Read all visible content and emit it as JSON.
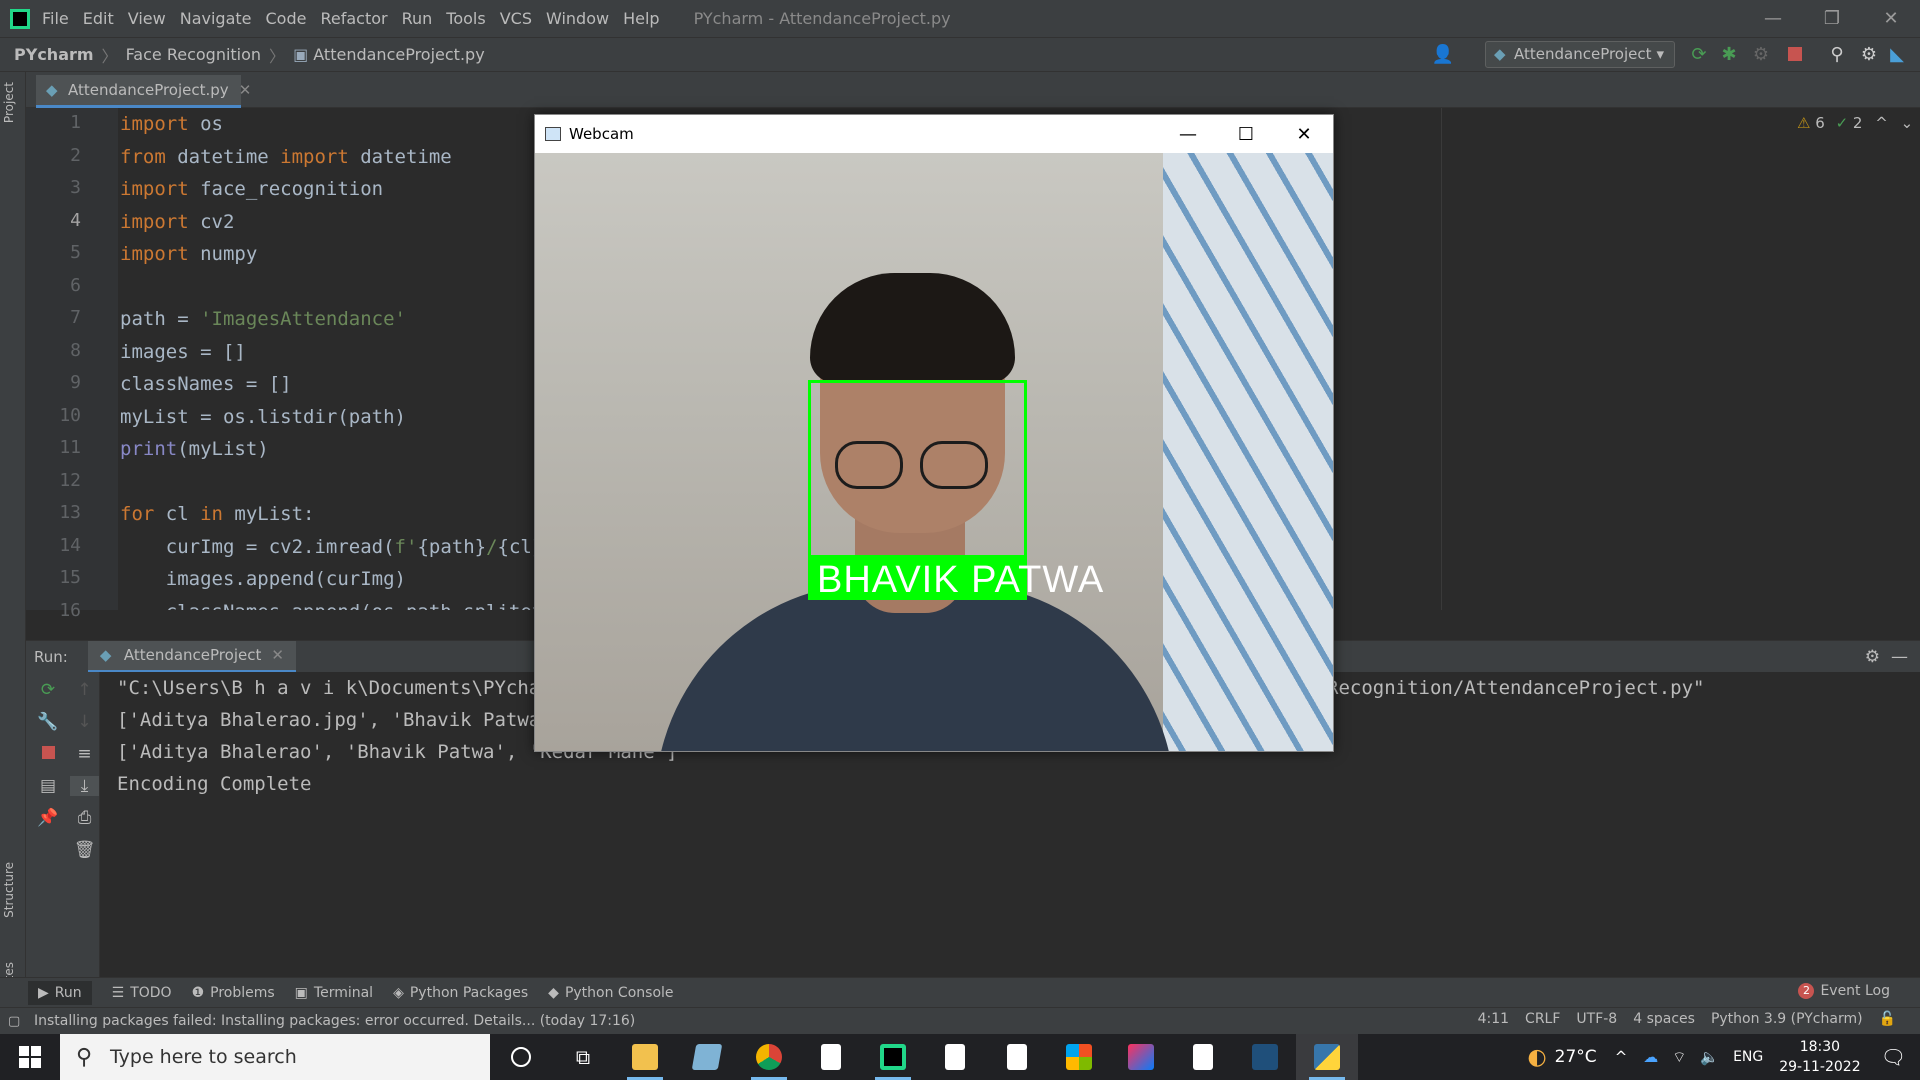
{
  "window": {
    "title": "PYcharm - AttendanceProject.py"
  },
  "menu": [
    "File",
    "Edit",
    "View",
    "Navigate",
    "Code",
    "Refactor",
    "Run",
    "Tools",
    "VCS",
    "Window",
    "Help"
  ],
  "breadcrumb": {
    "project": "PYcharm",
    "folder": "Face Recognition",
    "file": "AttendanceProject.py"
  },
  "run_config": "AttendanceProject",
  "editor": {
    "tab": "AttendanceProject.py",
    "inspections": {
      "warnings": "6",
      "weak": "2"
    },
    "line_numbers": [
      "1",
      "2",
      "3",
      "4",
      "5",
      "6",
      "7",
      "8",
      "9",
      "10",
      "11",
      "12",
      "13",
      "14",
      "15",
      "16"
    ],
    "lines": [
      [
        {
          "t": "import",
          "c": "kw"
        },
        {
          "t": " os"
        }
      ],
      [
        {
          "t": "from",
          "c": "kw"
        },
        {
          "t": " datetime "
        },
        {
          "t": "import",
          "c": "kw"
        },
        {
          "t": " datetime"
        }
      ],
      [
        {
          "t": "import",
          "c": "kw"
        },
        {
          "t": " face_recognition"
        }
      ],
      [
        {
          "t": "import",
          "c": "kw"
        },
        {
          "t": " cv2"
        }
      ],
      [
        {
          "t": "import",
          "c": "kw"
        },
        {
          "t": " numpy"
        }
      ],
      [
        {
          "t": ""
        }
      ],
      [
        {
          "t": "path = "
        },
        {
          "t": "'ImagesAttendance'",
          "c": "str"
        }
      ],
      [
        {
          "t": "images = []"
        }
      ],
      [
        {
          "t": "classNames = []"
        }
      ],
      [
        {
          "t": "myList = os.listdir(path)"
        }
      ],
      [
        {
          "t": "print",
          "c": "fn"
        },
        {
          "t": "(myList)"
        }
      ],
      [
        {
          "t": ""
        }
      ],
      [
        {
          "t": "for",
          "c": "kw"
        },
        {
          "t": " cl "
        },
        {
          "t": "in",
          "c": "kw"
        },
        {
          "t": " myList:"
        }
      ],
      [
        {
          "t": "    curImg = cv2.imread("
        },
        {
          "t": "f'",
          "c": "str"
        },
        {
          "t": "{path}"
        },
        {
          "t": "/",
          "c": "str"
        },
        {
          "t": "{cl}"
        },
        {
          "t": "'",
          "c": "str"
        }
      ],
      [
        {
          "t": "    images.append(curImg)"
        }
      ],
      [
        {
          "t": "    classNames.append(os.path.splitext"
        }
      ]
    ]
  },
  "run": {
    "label": "Run:",
    "tab": "AttendanceProject",
    "output": [
      "\"C:\\Users\\B h a v i k\\Documents\\PYchar",
      "['Aditya Bhalerao.jpg', 'Bhavik Patwa.",
      "['Aditya Bhalerao', 'Bhavik Patwa', 'Kedar Mane']",
      "Encoding Complete"
    ],
    "output_tail": "Recognition/AttendanceProject.py\""
  },
  "webcam": {
    "title": "Webcam",
    "label": "BHAVIK PATWA"
  },
  "side_labels": {
    "project": "Project",
    "structure": "Structure",
    "favorites": "Favorites"
  },
  "bottom_tabs": [
    "Run",
    "TODO",
    "Problems",
    "Terminal",
    "Python Packages",
    "Python Console"
  ],
  "event_log": {
    "count": "2",
    "label": "Event Log"
  },
  "status": {
    "message": "Installing packages failed: Installing packages: error occurred. Details... (today 17:16)",
    "position": "4:11",
    "line_sep": "CRLF",
    "encoding": "UTF-8",
    "indent": "4 spaces",
    "interpreter": "Python 3.9 (PYcharm)"
  },
  "taskbar": {
    "search_placeholder": "Type here to search",
    "weather": "27°C",
    "lang": "ENG",
    "time": "18:30",
    "date": "29-11-2022"
  }
}
